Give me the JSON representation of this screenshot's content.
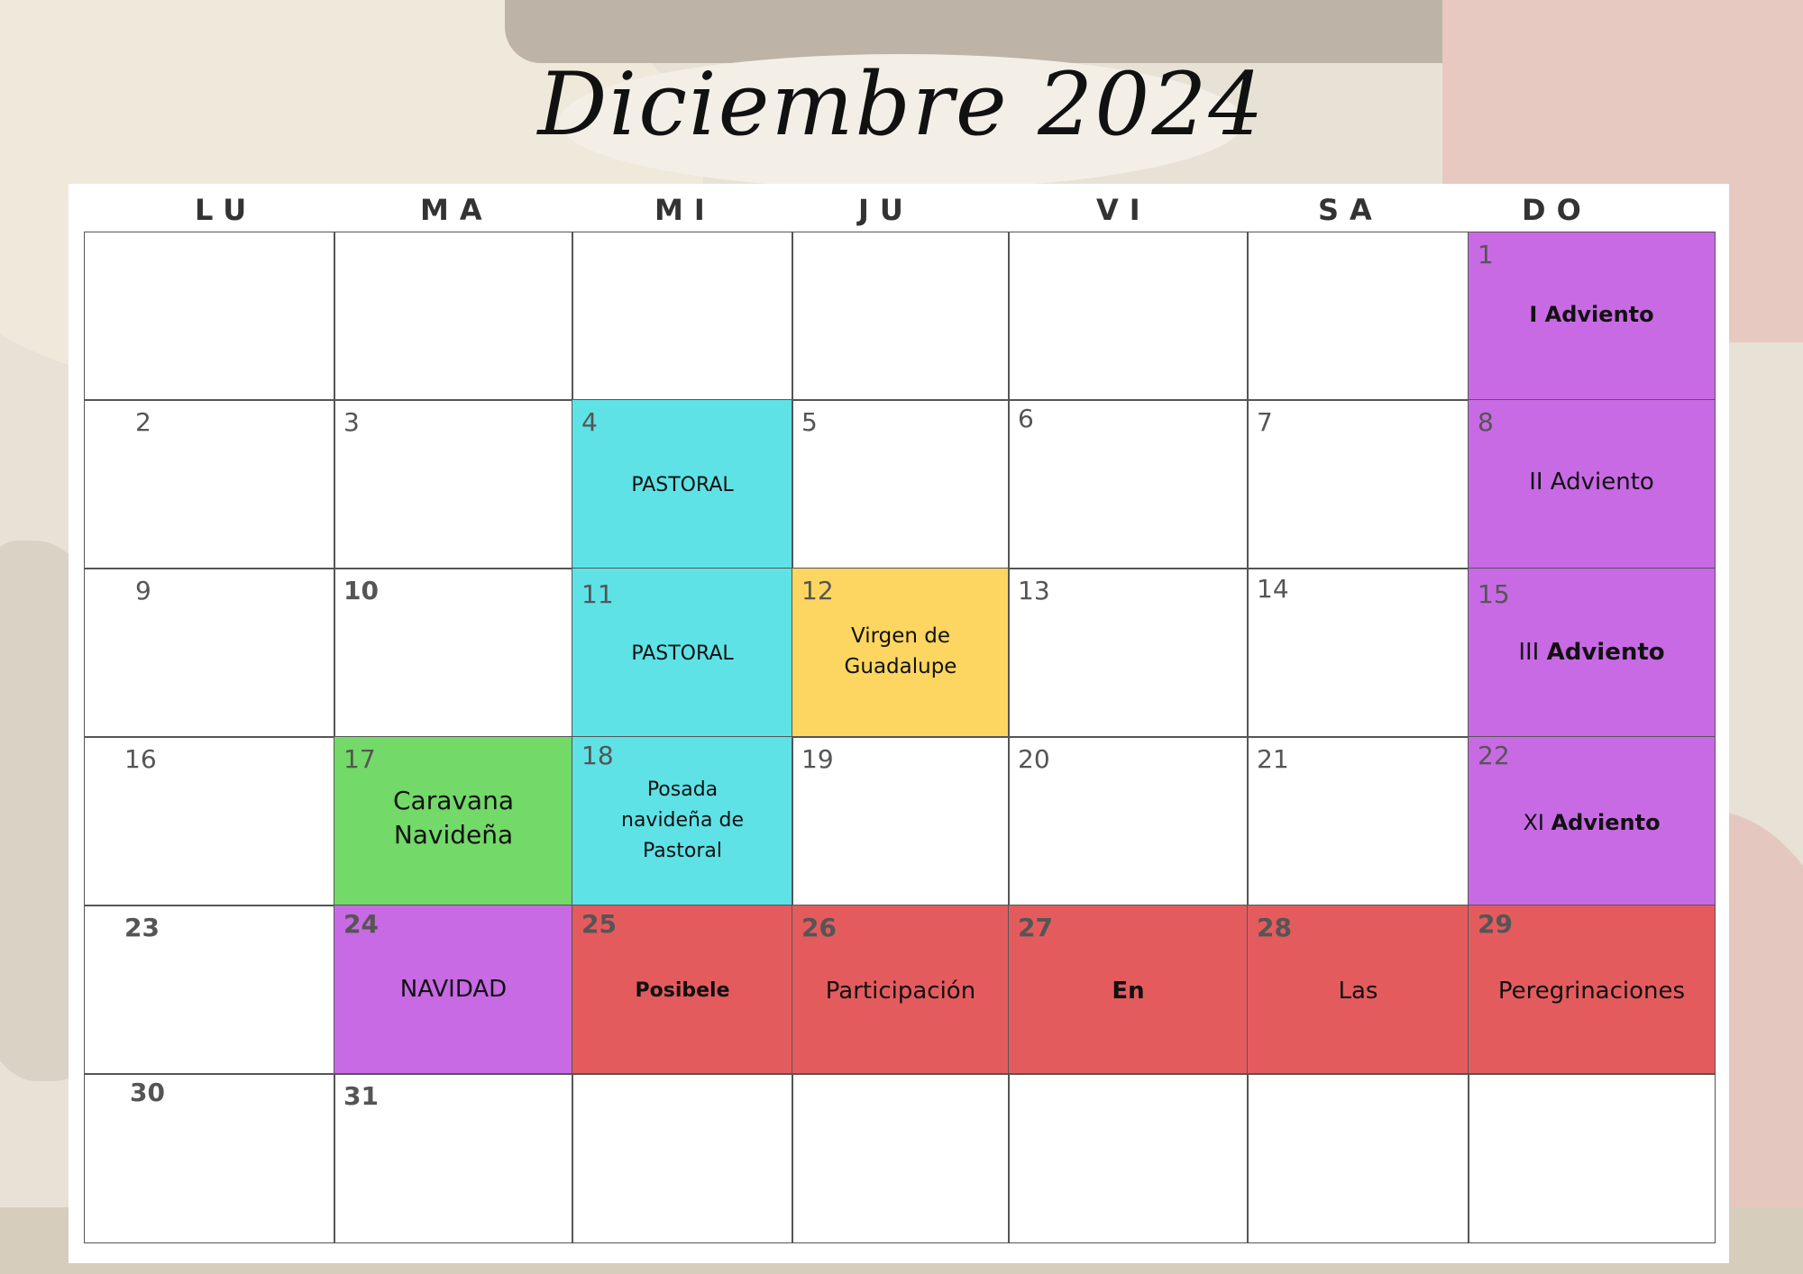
{
  "title": "Diciembre 2024",
  "weekdays": [
    "LU",
    "MA",
    "MI",
    "JU",
    "VI",
    "SA",
    "DO"
  ],
  "colors": {
    "purple": "#c86ae4",
    "cyan": "#5ee2e6",
    "yellow": "#fcd660",
    "green": "#73d968",
    "red": "#e45b5e"
  },
  "days": {
    "d1": "1",
    "d2": "2",
    "d3": "3",
    "d4": "4",
    "d5": "5",
    "d6": "6",
    "d7": "7",
    "d8": "8",
    "d9": "9",
    "d10": "10",
    "d11": "11",
    "d12": "12",
    "d13": "13",
    "d14": "14",
    "d15": "15",
    "d16": "16",
    "d17": "17",
    "d18": "18",
    "d19": "19",
    "d20": "20",
    "d21": "21",
    "d22": "22",
    "d23": "23",
    "d24": "24",
    "d25": "25",
    "d26": "26",
    "d27": "27",
    "d28": "28",
    "d29": "29",
    "d30": "30",
    "d31": "31"
  },
  "events": {
    "e1": "I Adviento",
    "e4": "PASTORAL",
    "e8": "II Adviento",
    "e11": "PASTORAL",
    "e12_line1": "Virgen de",
    "e12_line2": "Guadalupe",
    "e15_prefix": "III",
    "e15_word": "Adviento",
    "e17_line1": "Caravana",
    "e17_line2": "Navideña",
    "e18_line1": "Posada",
    "e18_line2": "navideña de",
    "e18_line3": "Pastoral",
    "e22_prefix": "XI",
    "e22_word": "Adviento",
    "e24": "NAVIDAD",
    "e25": "Posibele",
    "e26": "Participación",
    "e27": "En",
    "e28": "Las",
    "e29": "Peregrinaciones"
  }
}
